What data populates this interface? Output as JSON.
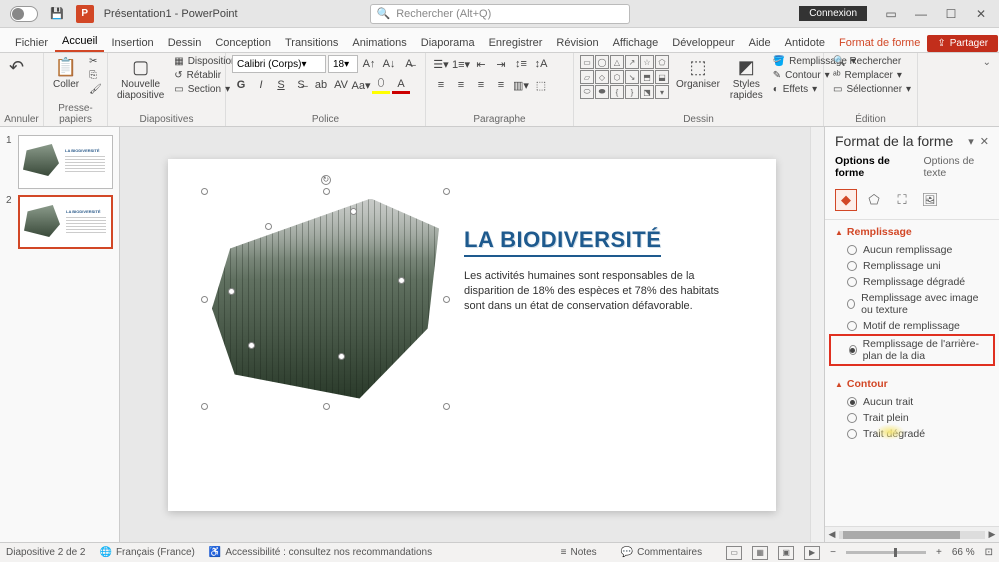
{
  "titlebar": {
    "doc": "Présentation1 - PowerPoint",
    "search": "Rechercher (Alt+Q)",
    "login": "Connexion"
  },
  "tabs": [
    "Fichier",
    "Accueil",
    "Insertion",
    "Dessin",
    "Conception",
    "Transitions",
    "Animations",
    "Diaporama",
    "Enregistrer",
    "Révision",
    "Affichage",
    "Développeur",
    "Aide",
    "Antidote",
    "Format de forme"
  ],
  "active_tab": "Accueil",
  "share": "Partager",
  "ribbon": {
    "undo": "Annuler",
    "paste": "Coller",
    "clipboard": "Presse-papiers",
    "newslide": "Nouvelle diapositive",
    "layout": "Disposition",
    "reset": "Rétablir",
    "section": "Section",
    "slides": "Diapositives",
    "font": "Calibri (Corps)",
    "fontsize": "18",
    "fontgroup": "Police",
    "para": "Paragraphe",
    "arrange": "Organiser",
    "styles": "Styles rapides",
    "fill": "Remplissage",
    "outline": "Contour",
    "effects": "Effets",
    "draw": "Dessin",
    "find": "Rechercher",
    "replace": "Remplacer",
    "select": "Sélectionner",
    "edit": "Édition"
  },
  "thumbs": {
    "count": 2,
    "active": 2
  },
  "slide": {
    "title": "LA BIODIVERSITÉ",
    "body": "Les activités humaines sont responsables de la disparition de 18% des espèces et 78% des habitats sont dans un état de conservation défavorable."
  },
  "fpane": {
    "title": "Format de la forme",
    "tab1": "Options de forme",
    "tab2": "Options de texte",
    "sec_fill": "Remplissage",
    "fill_opts": [
      "Aucun remplissage",
      "Remplissage uni",
      "Remplissage dégradé",
      "Remplissage avec image ou texture",
      "Motif de remplissage",
      "Remplissage de l'arrière-plan de la dia"
    ],
    "fill_selected": 5,
    "sec_line": "Contour",
    "line_opts": [
      "Aucun trait",
      "Trait plein",
      "Trait dégradé"
    ],
    "line_selected": 0
  },
  "status": {
    "slide": "Diapositive 2 de 2",
    "lang": "Français (France)",
    "acc": "Accessibilité : consultez nos recommandations",
    "notes": "Notes",
    "comments": "Commentaires",
    "zoom": "66 %"
  }
}
